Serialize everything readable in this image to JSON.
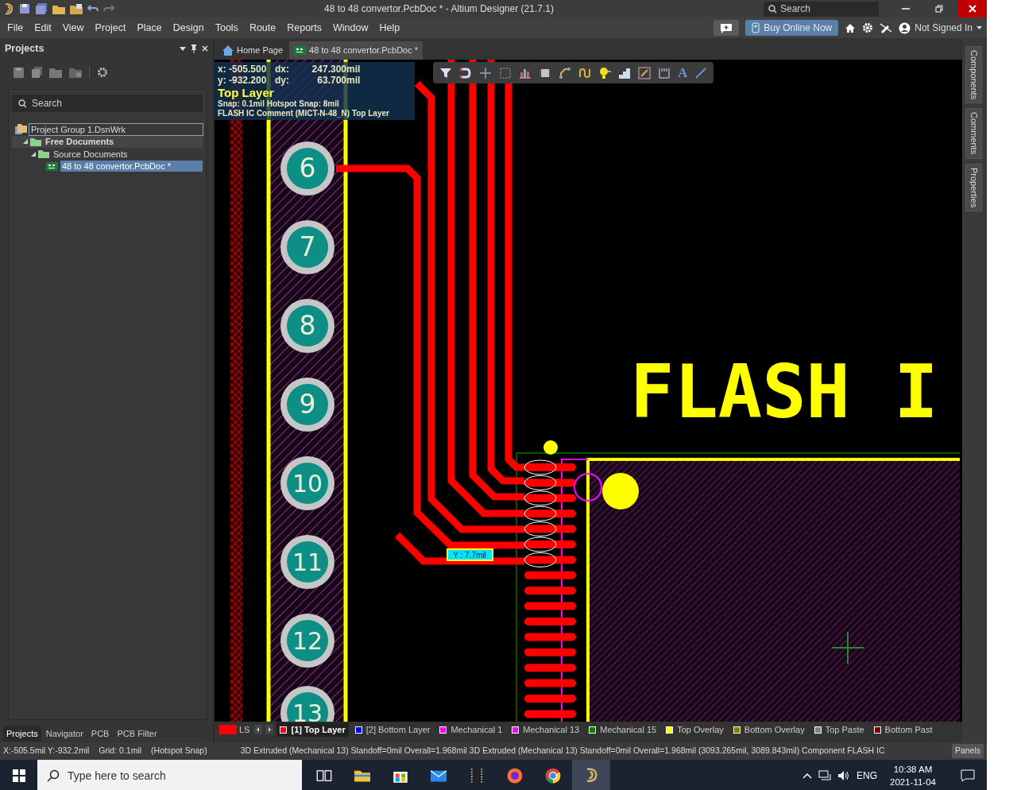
{
  "title_bar": {
    "title": "48 to 48 convertor.PcbDoc * - Altium Designer (21.7.1)",
    "search_placeholder": "Search"
  },
  "menu": [
    "File",
    "Edit",
    "View",
    "Project",
    "Place",
    "Design",
    "Tools",
    "Route",
    "Reports",
    "Window",
    "Help"
  ],
  "menu_right": {
    "buy_button": "Buy Online Now",
    "user": "Not Signed In"
  },
  "projects_panel": {
    "title": "Projects",
    "search_placeholder": "Search",
    "tree": [
      {
        "label": "Project Group 1.DsnWrk",
        "kind": "workspace",
        "selected": false,
        "focused": true,
        "children": [
          {
            "label": "Free Documents",
            "kind": "project",
            "selected": false,
            "expanded": true,
            "children": [
              {
                "label": "Source Documents",
                "kind": "folder",
                "selected": false,
                "expanded": true,
                "children": [
                  {
                    "label": "48 to 48 convertor.PcbDoc *",
                    "kind": "pcb",
                    "selected": true
                  }
                ]
              }
            ]
          }
        ]
      }
    ],
    "tabs": [
      {
        "label": "Projects",
        "selected": true
      },
      {
        "label": "Navigator",
        "selected": false
      },
      {
        "label": "PCB",
        "selected": false
      },
      {
        "label": "PCB Filter",
        "selected": false
      }
    ]
  },
  "document_tabs": [
    {
      "label": "Home Page",
      "kind": "home",
      "selected": false
    },
    {
      "label": "48 to 48 convertor.PcbDoc *",
      "kind": "pcb",
      "selected": true
    }
  ],
  "hud": {
    "rows": [
      [
        "x:",
        "-505.500",
        "dx:",
        "247.300",
        "mil"
      ],
      [
        "y:",
        "-932.200",
        "dy:",
        "63.700",
        "mil"
      ]
    ],
    "layer": "Top Layer",
    "snap": "Snap: 0.1mil Hotspot Snap: 8mil",
    "info": "FLASH IC  Comment (MICT-N-48_N)  Top Layer"
  },
  "toolbar": {
    "text_tool": "A"
  },
  "pcb": {
    "pads": [
      "6",
      "7",
      "8",
      "9",
      "10",
      "11",
      "12",
      "13"
    ],
    "silkscreen_text": "FLASH I",
    "measure_label": "Y : 7.7mil"
  },
  "right_tabs": [
    "Components",
    "Comments",
    "Properties"
  ],
  "layer_bar": {
    "ls": "LS",
    "layers": [
      {
        "name": "[1] Top Layer",
        "color": "#ff0000",
        "selected": true
      },
      {
        "name": "[2] Bottom Layer",
        "color": "#0000ff",
        "selected": false
      },
      {
        "name": "Mechanical 1",
        "color": "#ff00ff",
        "selected": false
      },
      {
        "name": "Mechanical 13",
        "color": "#ff00ff",
        "selected": false
      },
      {
        "name": "Mechanical 15",
        "color": "#008000",
        "selected": false
      },
      {
        "name": "Top Overlay",
        "color": "#ffff00",
        "selected": false
      },
      {
        "name": "Bottom Overlay",
        "color": "#808000",
        "selected": false
      },
      {
        "name": "Top Paste",
        "color": "#808080",
        "selected": false
      },
      {
        "name": "Bottom Past",
        "color": "#800000",
        "selected": false
      }
    ]
  },
  "status_bar": {
    "items": [
      "X:-505.5mil Y:-932.2mil",
      "Grid: 0.1mil",
      "(Hotspot Snap)",
      "3D Extruded  (Mechanical 13)  Standoff=0mil  Overall=1.968mil  3D Extruded  (Mechanical 13)  Standoff=0mil  Overall=1.968mil  (3093.265mil, 3089.843mil)  Component FLASH IC"
    ],
    "panels_button": "Panels"
  },
  "taskbar": {
    "search_placeholder": "Type here to search",
    "language": "ENG",
    "time": "10:38 AM",
    "date": "2021-11-04"
  }
}
